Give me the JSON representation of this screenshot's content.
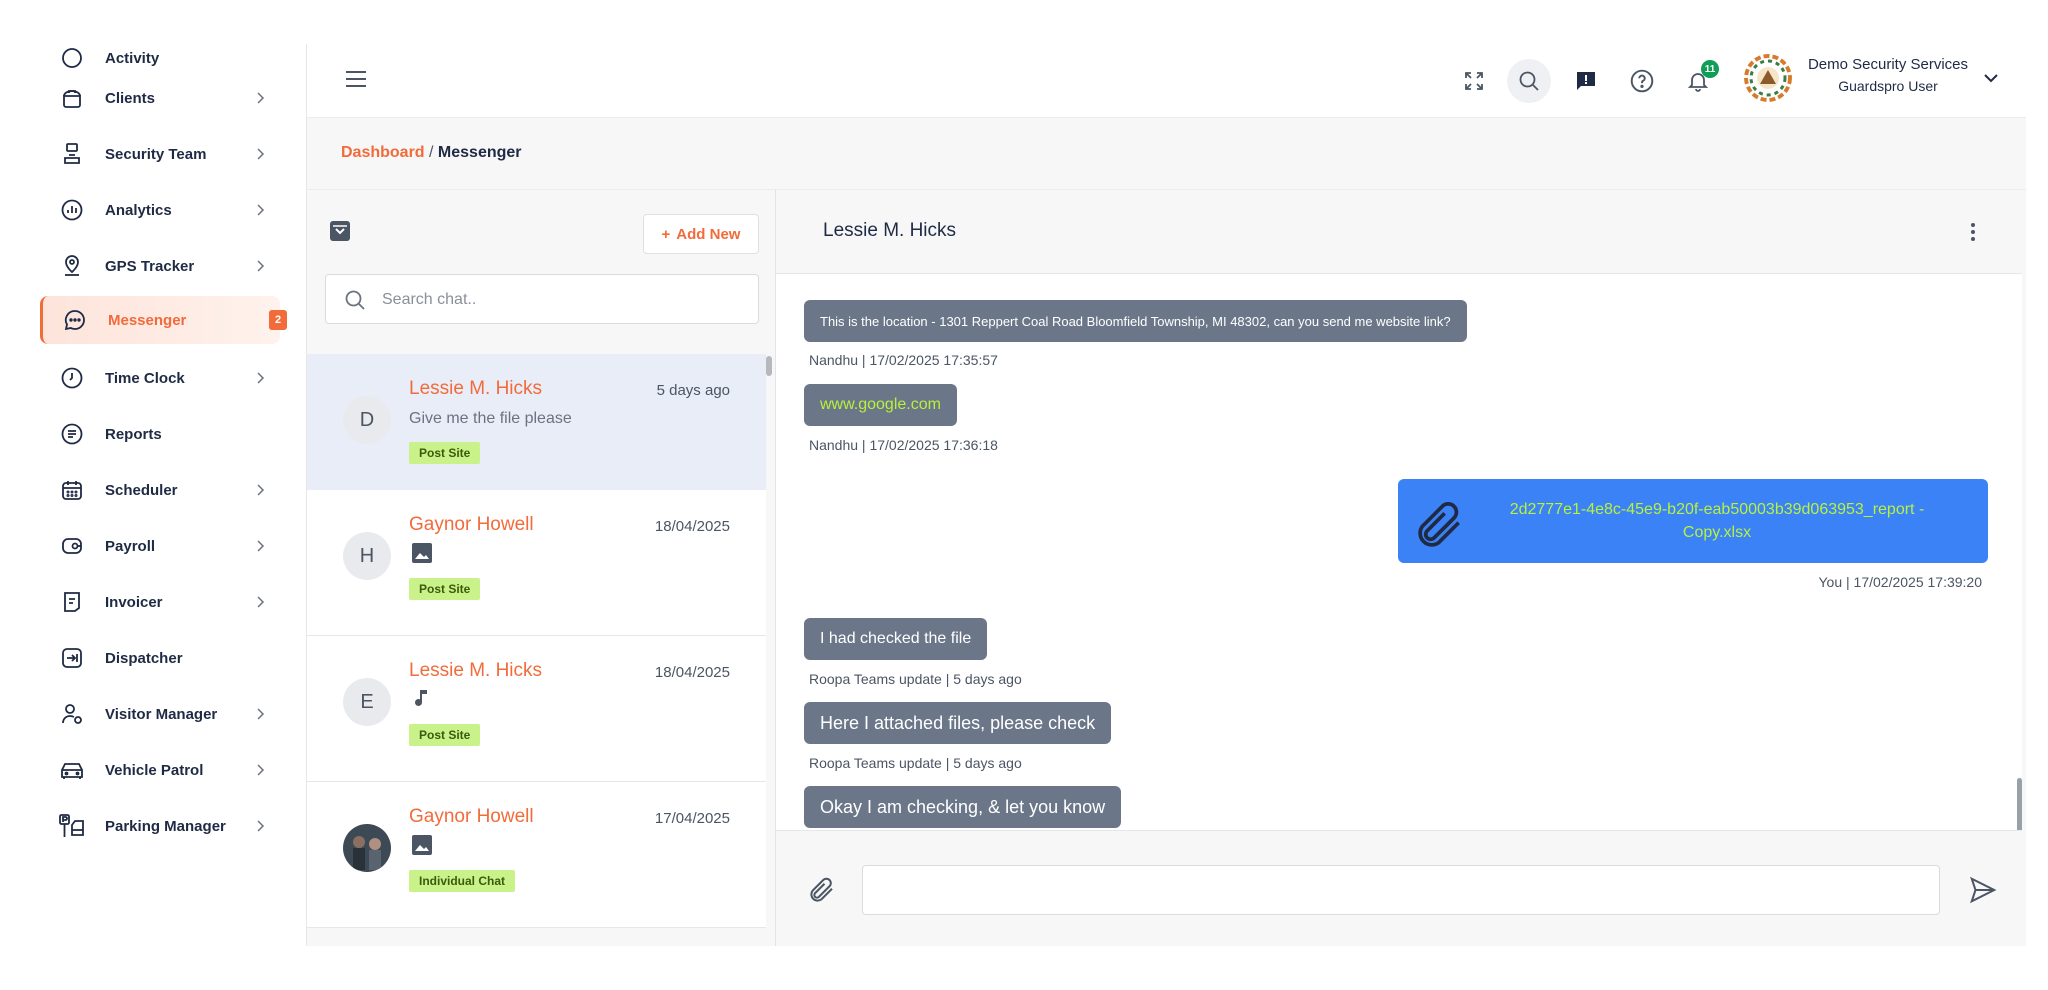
{
  "sidebar": {
    "items": [
      {
        "label": "Activity"
      },
      {
        "label": "Clients"
      },
      {
        "label": "Security Team"
      },
      {
        "label": "Analytics"
      },
      {
        "label": "GPS Tracker"
      },
      {
        "label": "Messenger",
        "badge": "2"
      },
      {
        "label": "Time Clock"
      },
      {
        "label": "Reports"
      },
      {
        "label": "Scheduler"
      },
      {
        "label": "Payroll"
      },
      {
        "label": "Invoicer"
      },
      {
        "label": "Dispatcher"
      },
      {
        "label": "Visitor Manager"
      },
      {
        "label": "Vehicle Patrol"
      },
      {
        "label": "Parking Manager"
      }
    ]
  },
  "topbar": {
    "notification_count": "11",
    "user_name": "Demo Security Services",
    "user_role": "Guardspro User"
  },
  "breadcrumb": {
    "root": "Dashboard",
    "separator": " / ",
    "current": "Messenger"
  },
  "chat_list": {
    "add_new_label": "Add New",
    "search_placeholder": "Search chat..",
    "items": [
      {
        "initial": "D",
        "name": "Lessie M. Hicks",
        "time": "5 days ago",
        "preview": "Give me the file please",
        "tag": "Post Site"
      },
      {
        "initial": "H",
        "name": "Gaynor Howell",
        "time": "18/04/2025",
        "preview_icon": "image-icon",
        "tag": "Post Site"
      },
      {
        "initial": "E",
        "name": "Lessie M. Hicks",
        "time": "18/04/2025",
        "preview_icon": "music-note-icon",
        "tag": "Post Site"
      },
      {
        "initial": "",
        "name": "Gaynor Howell",
        "time": "17/04/2025",
        "preview_icon": "image-icon",
        "tag": "Individual Chat"
      }
    ]
  },
  "conversation": {
    "title": "Lessie M. Hicks",
    "messages": [
      {
        "text": "This is the location - 1301 Reppert Coal Road Bloomfield Township, MI 48302, can you send me website link?",
        "meta": "Nandhu | 17/02/2025 17:35:57"
      },
      {
        "text": "www.google.com",
        "meta": "Nandhu | 17/02/2025 17:36:18"
      },
      {
        "text": "2d2777e1-4e8c-45e9-b20f-eab50003b39d063953_report - Copy.xlsx",
        "meta": "You | 17/02/2025 17:39:20"
      },
      {
        "text": "I had checked the file",
        "meta": "Roopa Teams update | 5 days ago"
      },
      {
        "text": "Here I attached files, please check",
        "meta": "Roopa Teams update | 5 days ago"
      },
      {
        "text": "Okay I am checking, & let you know",
        "meta": ""
      }
    ]
  },
  "colors": {
    "accent": "#f26b3a",
    "received_bubble": "#6b7789",
    "sent_bubble": "#3b82f6",
    "link": "#b8f23d",
    "tag_bg": "#c9f28a"
  }
}
